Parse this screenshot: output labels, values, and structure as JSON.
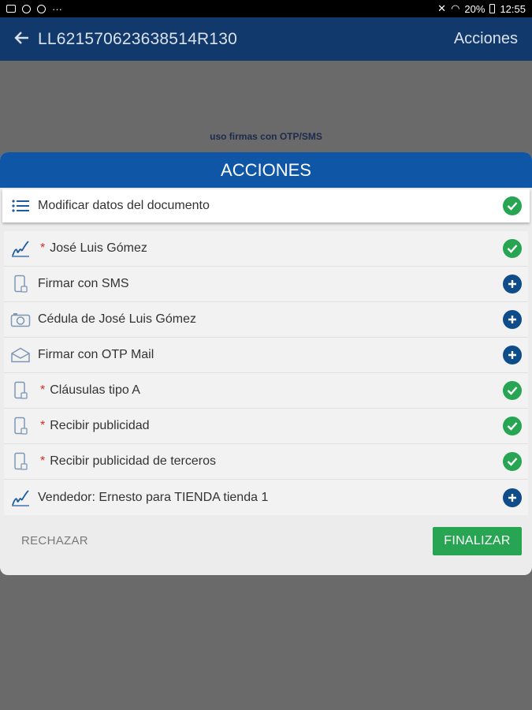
{
  "statusbar": {
    "battery": "20%",
    "time": "12:55",
    "more": "···"
  },
  "appbar": {
    "back_icon": "arrow-left-icon",
    "title": "LL621570623638514R130",
    "actions_label": "Acciones"
  },
  "background": {
    "overlay_text": "uso firmas con OTP/SMS"
  },
  "dialog": {
    "title": "ACCIONES",
    "top_item": {
      "icon": "list-icon",
      "label": "Modificar datos del documento",
      "status": "check"
    },
    "items": [
      {
        "icon": "signature-icon",
        "required": true,
        "label": "José Luis Gómez",
        "status": "check"
      },
      {
        "icon": "phone-icon",
        "required": false,
        "label": "Firmar con SMS",
        "status": "plus"
      },
      {
        "icon": "camera-icon",
        "required": false,
        "label": "Cédula de José Luis Gómez",
        "status": "plus"
      },
      {
        "icon": "mail-icon",
        "required": false,
        "label": "Firmar con OTP Mail",
        "status": "plus"
      },
      {
        "icon": "phone-icon",
        "required": true,
        "label": "Cláusulas tipo A",
        "status": "check"
      },
      {
        "icon": "phone-icon",
        "required": true,
        "label": "Recibir publicidad",
        "status": "check"
      },
      {
        "icon": "phone-icon",
        "required": true,
        "label": "Recibir publicidad de terceros",
        "status": "check"
      },
      {
        "icon": "signature-icon",
        "required": false,
        "label": "Vendedor: Ernesto para TIENDA tienda 1",
        "status": "plus"
      }
    ],
    "reject_label": "RECHAZAR",
    "finish_label": "FINALIZAR"
  },
  "colors": {
    "appbar": "#12396b",
    "dialog_header": "#0f57a6",
    "check": "#27a552",
    "plus": "#0f4c8a",
    "required_star": "#d62b2b"
  }
}
